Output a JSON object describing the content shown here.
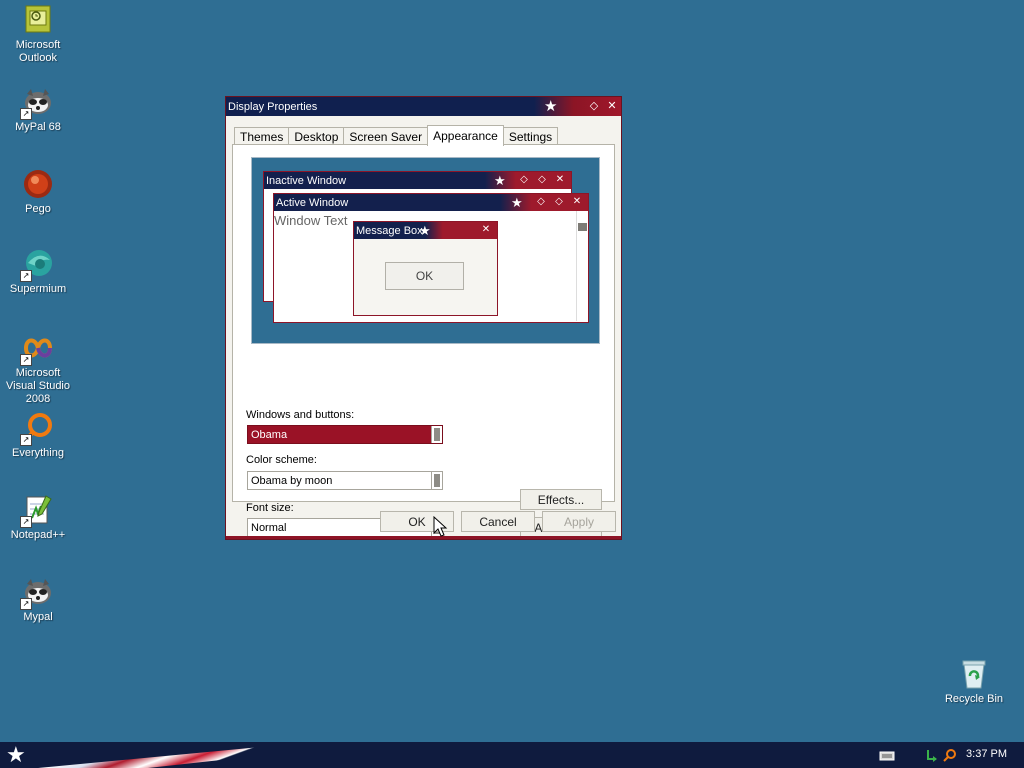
{
  "desktop": {
    "icons": [
      {
        "label": "Microsoft Outlook",
        "icon": "outlook-icon"
      },
      {
        "label": "MyPal 68",
        "icon": "raccoon-icon"
      },
      {
        "label": "Pego",
        "icon": "pego-icon"
      },
      {
        "label": "Supermium",
        "icon": "supermium-icon"
      },
      {
        "label": "Microsoft Visual Studio 2008",
        "icon": "visual-studio-icon"
      },
      {
        "label": "Everything",
        "icon": "everything-search-icon"
      },
      {
        "label": "Notepad++",
        "icon": "notepadpp-icon"
      },
      {
        "label": "Mypal",
        "icon": "raccoon-icon"
      },
      {
        "label": "Recycle Bin",
        "icon": "recycle-bin-icon"
      }
    ]
  },
  "dialog": {
    "title": "Display Properties",
    "tabs": [
      "Themes",
      "Desktop",
      "Screen Saver",
      "Appearance",
      "Settings"
    ],
    "active_tab": "Appearance",
    "preview": {
      "inactive_title": "Inactive Window",
      "active_title": "Active Window",
      "window_text": "Window Text",
      "message_title": "Message Box",
      "ok": "OK"
    },
    "fields": {
      "windows_buttons_label": "Windows and buttons:",
      "windows_buttons_value": "Obama",
      "color_scheme_label": "Color scheme:",
      "color_scheme_value": "Obama by moon",
      "font_size_label": "Font size:",
      "font_size_value": "Normal"
    },
    "effects_button": "Effects...",
    "advanced_button": "Advanced",
    "ok_button": "OK",
    "cancel_button": "Cancel",
    "apply_button": "Apply"
  },
  "taskbar": {
    "clock": "3:37 PM"
  },
  "colors": {
    "desktop": "#2f6e93",
    "title_navy": "#10204f",
    "title_red": "#a0172b",
    "selection": "#9a1226"
  }
}
